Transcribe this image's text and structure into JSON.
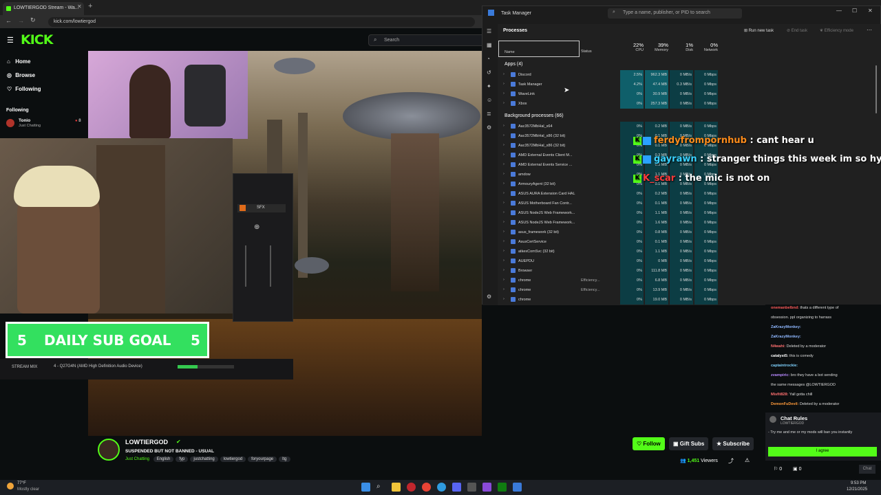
{
  "browser": {
    "tab_title": "LOWTIERGOD Stream - Wa...",
    "url": "kick.com/lowtiergod"
  },
  "kick": {
    "logo": "KICK",
    "search_placeholder": "Search",
    "nav": [
      {
        "label": "Home",
        "icon": "home-icon"
      },
      {
        "label": "Browse",
        "icon": "compass-icon"
      },
      {
        "label": "Following",
        "icon": "heart-icon"
      }
    ],
    "following_title": "Following",
    "following_user": {
      "name": "Tonio",
      "category": "Just Chatting",
      "viewers": "8"
    }
  },
  "overlay": {
    "daily_sub_goal": {
      "left": "5",
      "label": "DAILY SUB GOAL",
      "right": "5"
    },
    "stream_mix_label": "STREAM MIX",
    "audio_device": "4 - Q27G4N (AMD High Definition Audio Device)",
    "wavelink_channel": "SFX"
  },
  "task_manager": {
    "title": "Task Manager",
    "search_placeholder": "Type a name, publisher, or PID to search",
    "section": "Processes",
    "actions": [
      "Run new task",
      "End task",
      "Efficiency mode"
    ],
    "headers": {
      "name": "Name",
      "status": "Status",
      "cpu_pct": "22%",
      "cpu": "CPU",
      "mem_pct": "39%",
      "mem": "Memory",
      "disk_pct": "1%",
      "disk": "Disk",
      "net_pct": "0%",
      "net": "Network"
    },
    "apps_group": "Apps (4)",
    "apps": [
      {
        "name": "Discord",
        "cpu": "2.5%",
        "mem": "962.3 MB",
        "disk": "0 MB/s",
        "net": "0 Mbps"
      },
      {
        "name": "Task Manager",
        "cpu": "4.2%",
        "mem": "47.4 MB",
        "disk": "0.3 MB/s",
        "net": "0 Mbps"
      },
      {
        "name": "WaveLink",
        "cpu": "0%",
        "mem": "30.9 MB",
        "disk": "0 MB/s",
        "net": "0 Mbps"
      },
      {
        "name": "Xbox",
        "cpu": "0%",
        "mem": "257.3 MB",
        "disk": "0 MB/s",
        "net": "0 Mbps"
      }
    ],
    "bg_group": "Background processes (66)",
    "bg": [
      {
        "name": "Aac3572MbHal_x64",
        "status": "",
        "cpu": "0%",
        "mem": "0.2 MB",
        "disk": "0 MB/s",
        "net": "0 Mbps"
      },
      {
        "name": "Aac3572MbHal_x86 (32 bit)",
        "status": "",
        "cpu": "0%",
        "mem": "0.1 MB",
        "disk": "0 MB/s",
        "net": "0 Mbps"
      },
      {
        "name": "Aac3572MbHal_x86 (32 bit)",
        "status": "",
        "cpu": "0%",
        "mem": "0.1 MB",
        "disk": "0 MB/s",
        "net": "0 Mbps"
      },
      {
        "name": "AMD External Events Client M...",
        "status": "",
        "cpu": "0%",
        "mem": "0.3 MB",
        "disk": "0 MB/s",
        "net": "0 Mbps"
      },
      {
        "name": "AMD External Events Service ...",
        "status": "",
        "cpu": "0%",
        "mem": "0.3 MB",
        "disk": "0 MB/s",
        "net": "0 Mbps"
      },
      {
        "name": "amdow",
        "status": "",
        "cpu": "0%",
        "mem": "1.1 MB",
        "disk": "0 MB/s",
        "net": "0 Mbps"
      },
      {
        "name": "ArmouryAgent (32 bit)",
        "status": "",
        "cpu": "0%",
        "mem": "0.1 MB",
        "disk": "0 MB/s",
        "net": "0 Mbps"
      },
      {
        "name": "ASUS AURA Extension Card HAL",
        "status": "",
        "cpu": "0%",
        "mem": "0.2 MB",
        "disk": "0 MB/s",
        "net": "0 Mbps"
      },
      {
        "name": "ASUS Motherboard Fan Contr...",
        "status": "",
        "cpu": "0%",
        "mem": "0.1 MB",
        "disk": "0 MB/s",
        "net": "0 Mbps"
      },
      {
        "name": "ASUS NodeJS Web Framework...",
        "status": "",
        "cpu": "0%",
        "mem": "1.1 MB",
        "disk": "0 MB/s",
        "net": "0 Mbps"
      },
      {
        "name": "ASUS NodeJS Web Framework...",
        "status": "",
        "cpu": "0%",
        "mem": "1.6 MB",
        "disk": "0 MB/s",
        "net": "0 Mbps"
      },
      {
        "name": "asus_framework (32 bit)",
        "status": "",
        "cpu": "0%",
        "mem": "0.8 MB",
        "disk": "0 MB/s",
        "net": "0 Mbps"
      },
      {
        "name": "AsusCertService",
        "status": "",
        "cpu": "0%",
        "mem": "0.1 MB",
        "disk": "0 MB/s",
        "net": "0 Mbps"
      },
      {
        "name": "atkexComSvc (32 bit)",
        "status": "",
        "cpu": "0%",
        "mem": "1.1 MB",
        "disk": "0 MB/s",
        "net": "0 Mbps"
      },
      {
        "name": "AUEPDU",
        "status": "",
        "cpu": "0%",
        "mem": "0 MB",
        "disk": "0 MB/s",
        "net": "0 Mbps"
      },
      {
        "name": "Browser",
        "status": "",
        "cpu": "0%",
        "mem": "111.8 MB",
        "disk": "0 MB/s",
        "net": "0 Mbps"
      },
      {
        "name": "chrome",
        "status": "Efficiency...",
        "cpu": "0%",
        "mem": "6.8 MB",
        "disk": "0 MB/s",
        "net": "0 Mbps"
      },
      {
        "name": "chrome",
        "status": "Efficiency...",
        "cpu": "0%",
        "mem": "13.9 MB",
        "disk": "0 MB/s",
        "net": "0 Mbps"
      },
      {
        "name": "chrome",
        "status": "",
        "cpu": "0%",
        "mem": "19.0 MB",
        "disk": "0 MB/s",
        "net": "0 Mbps"
      }
    ]
  },
  "chat_overlay": [
    {
      "user": "ferdyfrompornhub",
      "user_color": "#ff8c1a",
      "msg": " : cant hear u"
    },
    {
      "user": "gayrawn",
      "user_color": "#3ad1ff",
      "msg": " : stranger things this week im so hyped"
    },
    {
      "user": "K_scar",
      "user_color": "#ff3a3a",
      "msg": " : the mic is not on"
    }
  ],
  "chat": {
    "lines": [
      {
        "user": "onemanbelbnd:",
        "user_color": "#ff5a5a",
        "msg": "thats a different type of"
      },
      {
        "user": "",
        "user_color": "#ddd",
        "msg": "obsession. ppl organizing to harrass"
      },
      {
        "user": "ZaKrazyMonkey:",
        "user_color": "#8fb8ff",
        "msg": ""
      },
      {
        "user": "ZaKrazyMonkey:",
        "user_color": "#8fb8ff",
        "msg": ""
      },
      {
        "user": "N4wahi:",
        "user_color": "#ff7070",
        "msg": "Deleted by a moderator"
      },
      {
        "user": "catalyst5:",
        "user_color": "#ffffff",
        "msg": "this is comedy"
      },
      {
        "user": "captaintrockie:",
        "user_color": "#7fd2ff",
        "msg": ""
      },
      {
        "user": "zvampiric:",
        "user_color": "#b889ff",
        "msg": "bro they have a bot sending"
      },
      {
        "user": "",
        "user_color": "#ddd",
        "msg": "the same messages @LOWTIERGOD"
      },
      {
        "user": "Misfit828:",
        "user_color": "#ff7070",
        "msg": "Yall gotta chill"
      },
      {
        "user": "DemonFuDevil:",
        "user_color": "#ff9a3a",
        "msg": "Deleted by a moderator"
      }
    ],
    "rules_title": "Chat Rules",
    "rules_sub": "LOWTIERGOD",
    "rules_text": "- Try me and me or my mods will ban you instantly",
    "agree_label": "I agree",
    "kicks_count": "0",
    "gift_count": "0",
    "chat_button": "Chat"
  },
  "channel": {
    "name": "LOWTIERGOD",
    "title": "SUSPENDED BUT NOT BANNED  - USUAL",
    "category": "Just Chatting",
    "tags": [
      "English",
      "fyp",
      "justchatting",
      "lowtiergod",
      "foryourpage",
      "ltg"
    ],
    "follow_label": "Follow",
    "gift_label": "Gift Subs",
    "subscribe_label": "Subscribe",
    "viewers": "1,451",
    "viewers_label": "Viewers"
  },
  "taskbar": {
    "weather_temp": "77°F",
    "weather_text": "Mostly clear",
    "time": "9:53 PM",
    "date": "12/21/2025"
  }
}
